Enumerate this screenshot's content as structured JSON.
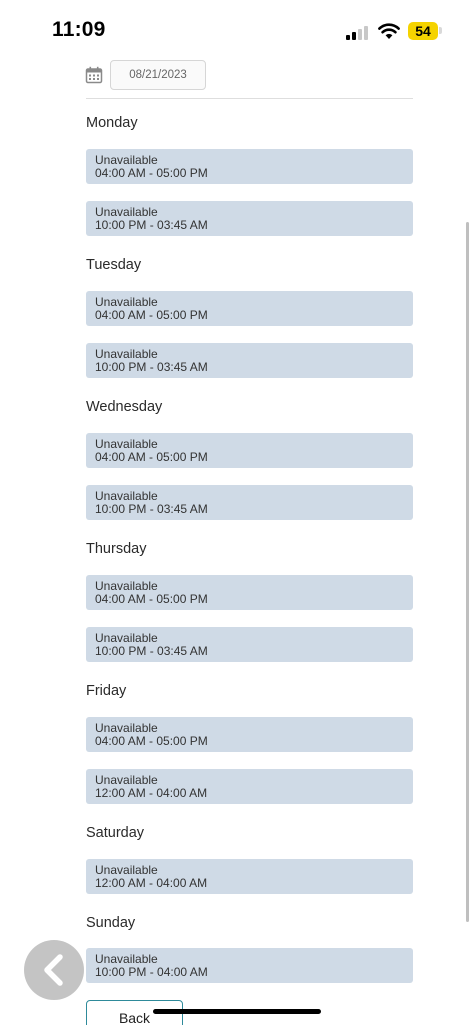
{
  "status_bar": {
    "time": "11:09",
    "battery": "54"
  },
  "date_picker": {
    "value": "08/21/2023"
  },
  "days": [
    {
      "name": "Monday",
      "slots": [
        {
          "status": "Unavailable",
          "time": "04:00 AM - 05:00 PM"
        },
        {
          "status": "Unavailable",
          "time": "10:00 PM - 03:45 AM"
        }
      ]
    },
    {
      "name": "Tuesday",
      "slots": [
        {
          "status": "Unavailable",
          "time": "04:00 AM - 05:00 PM"
        },
        {
          "status": "Unavailable",
          "time": "10:00 PM - 03:45 AM"
        }
      ]
    },
    {
      "name": "Wednesday",
      "slots": [
        {
          "status": "Unavailable",
          "time": "04:00 AM - 05:00 PM"
        },
        {
          "status": "Unavailable",
          "time": "10:00 PM - 03:45 AM"
        }
      ]
    },
    {
      "name": "Thursday",
      "slots": [
        {
          "status": "Unavailable",
          "time": "04:00 AM - 05:00 PM"
        },
        {
          "status": "Unavailable",
          "time": "10:00 PM - 03:45 AM"
        }
      ]
    },
    {
      "name": "Friday",
      "slots": [
        {
          "status": "Unavailable",
          "time": "04:00 AM - 05:00 PM"
        },
        {
          "status": "Unavailable",
          "time": "12:00 AM - 04:00 AM"
        }
      ]
    },
    {
      "name": "Saturday",
      "slots": [
        {
          "status": "Unavailable",
          "time": "12:00 AM - 04:00 AM"
        }
      ]
    },
    {
      "name": "Sunday",
      "slots": [
        {
          "status": "Unavailable",
          "time": "10:00 PM - 04:00 AM"
        }
      ]
    }
  ],
  "footer": {
    "back_label": "Back"
  },
  "colors": {
    "slot_background": "#cfdae6",
    "back_button_border": "#2e8a9a",
    "battery": "#f5d300"
  },
  "icons": {
    "calendar": "calendar-icon",
    "back_circle": "chevron-left-icon"
  }
}
